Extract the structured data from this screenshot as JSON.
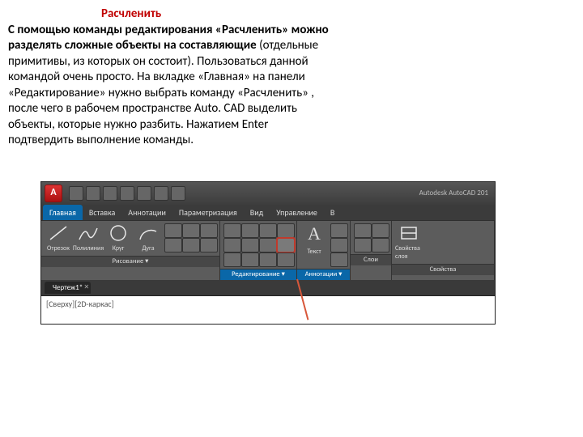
{
  "doc": {
    "heading": "Расчленить",
    "body_html": "<b>С помощью команды редактирования «Расчленить» можно разделять сложные объекты на составляющие</b> (отдельные примитивы, из которых он состоит). Пользоваться данной командой очень просто. На вкладке «Главная» на панели «Редактирование» нужно выбрать команду «Расчленить» , после чего в рабочем пространстве Auto. CAD выделить объекты, которые нужно разбить. Нажатием Enter подтвердить выполнение команды."
  },
  "acad": {
    "product": "Autodesk AutoCAD 201",
    "logo_letter": "A",
    "tabs": [
      "Главная",
      "Вставка",
      "Аннотации",
      "Параметризация",
      "Вид",
      "Управление",
      "В"
    ],
    "active_tab_index": 0,
    "panels": {
      "draw": {
        "title": "Рисование ▾",
        "tools": [
          "Отрезок",
          "Полилиния",
          "Круг",
          "Дуга"
        ]
      },
      "modify": {
        "title": "Редактирование ▾"
      },
      "annot": {
        "title": "Аннотации ▾",
        "text_label": "Текст"
      },
      "layers": {
        "title": "Слои"
      },
      "props": {
        "title": "Свойства",
        "sub": "Свойства слоя"
      }
    },
    "doc_tab": "Чертеж1*",
    "view_label": "[Сверху][2D-каркас]"
  }
}
